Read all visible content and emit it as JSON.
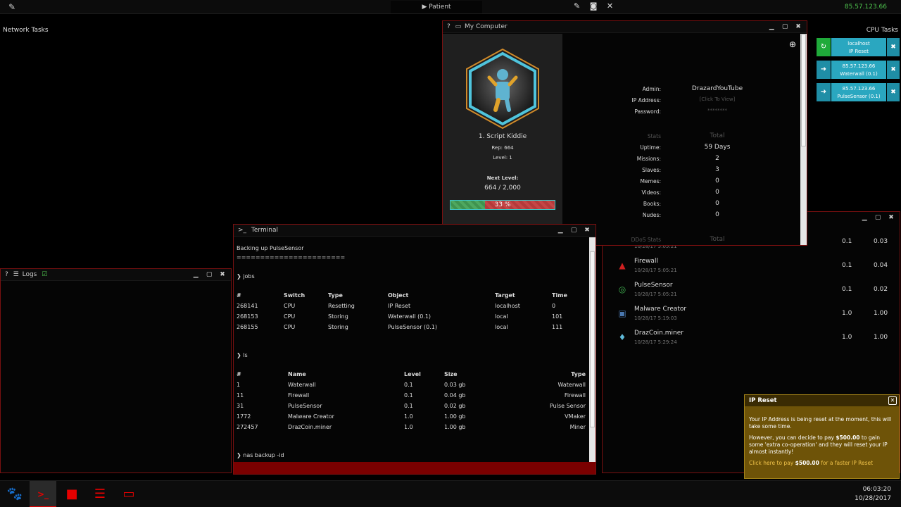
{
  "topbar": {
    "center_tab": "▶  Patient",
    "ip": "85.57.123.66"
  },
  "sections": {
    "network_tasks": "Network Tasks",
    "cpu_tasks": "CPU Tasks"
  },
  "my_computer": {
    "title": "My Computer",
    "rank": "1. Script Kiddie",
    "rep": "Rep: 664",
    "level": "Level: 1",
    "next_level_label": "Next Level:",
    "next_level_value": "664  / 2,000",
    "progress_percent": 33,
    "progress_text": "33 %",
    "info": [
      {
        "label": "Admin:",
        "value": "DrazardYouTube"
      },
      {
        "label": "IP Address:",
        "value": "[Click To View]"
      },
      {
        "label": "Password:",
        "value": "********"
      }
    ],
    "stats_header": {
      "label": "Stats",
      "value": "Total"
    },
    "stats": [
      {
        "label": "Uptime:",
        "value": "59 Days"
      },
      {
        "label": "Missions:",
        "value": "2"
      },
      {
        "label": "Slaves:",
        "value": "3"
      },
      {
        "label": "Memes:",
        "value": "0"
      },
      {
        "label": "Videos:",
        "value": "0"
      },
      {
        "label": "Books:",
        "value": "0"
      },
      {
        "label": "Nudes:",
        "value": "0"
      }
    ],
    "ddos_header": {
      "label": "DDoS Stats",
      "value": "Total"
    }
  },
  "cpu_tasks": [
    {
      "host": "localhost",
      "task": "IP Reset",
      "icon": "↻",
      "color": "#1faa3a"
    },
    {
      "host": "85.57.123.66",
      "task": "Waterwall (0.1)",
      "icon": "➜",
      "color": "#1f8ea6"
    },
    {
      "host": "85.57.123.66",
      "task": "PulseSensor (0.1)",
      "icon": "➜",
      "color": "#1f8ea6"
    }
  ],
  "logs": {
    "title": "Logs"
  },
  "terminal": {
    "title": "Terminal",
    "lines": {
      "backup": "Backing up PulseSensor",
      "separator": "=======================",
      "cmd_jobs": "jobs",
      "cmd_ls": "ls",
      "cmd_nas": "nas backup -id"
    },
    "jobs_headers": [
      "#",
      "Switch",
      "Type",
      "Object",
      "Target",
      "Time"
    ],
    "jobs_rows": [
      [
        "268141",
        "CPU",
        "Resetting",
        "IP Reset",
        "localhost",
        "0"
      ],
      [
        "268153",
        "CPU",
        "Storing",
        "Waterwall (0.1)",
        "local",
        "101"
      ],
      [
        "268155",
        "CPU",
        "Storing",
        "PulseSensor (0.1)",
        "local",
        "111"
      ]
    ],
    "ls_headers": [
      "#",
      "Name",
      "Level",
      "Size",
      "Type"
    ],
    "ls_rows": [
      [
        "1",
        "Waterwall",
        "0.1",
        "0.03 gb",
        "Waterwall"
      ],
      [
        "11",
        "Firewall",
        "0.1",
        "0.04 gb",
        "Firewall"
      ],
      [
        "31",
        "PulseSensor",
        "0.1",
        "0.02 gb",
        "Pulse Sensor"
      ],
      [
        "1772",
        "Malware Creator",
        "1.0",
        "1.00 gb",
        "VMaker"
      ],
      [
        "272457",
        "DrazCoin.miner",
        "1.0",
        "1.00 gb",
        "Miner"
      ]
    ]
  },
  "nas": {
    "items": [
      {
        "name": "",
        "date": "10/28/17 5:05:21",
        "level": "0.1",
        "size": "0.03",
        "icon": "",
        "color": "#777"
      },
      {
        "name": "Firewall",
        "date": "10/28/17 5:05:21",
        "level": "0.1",
        "size": "0.04",
        "icon": "▲",
        "color": "#d02020"
      },
      {
        "name": "PulseSensor",
        "date": "10/28/17 5:05:21",
        "level": "0.1",
        "size": "0.02",
        "icon": "◎",
        "color": "#3fae4f"
      },
      {
        "name": "Malware Creator",
        "date": "10/28/17 5:19:03",
        "level": "1.0",
        "size": "1.00",
        "icon": "▣",
        "color": "#4a78b0"
      },
      {
        "name": "DrazCoin.miner",
        "date": "10/28/17 5:29:24",
        "level": "1.0",
        "size": "1.00",
        "icon": "♦",
        "color": "#5fb9d8"
      }
    ]
  },
  "popup": {
    "title": "IP Reset",
    "p1": "Your IP Address is being reset at the moment, this will take some time.",
    "p2_pre": "However, you can decide to pay ",
    "p2_amount": "$500.00",
    "p2_post": " to gain some 'extra co-operation' and they will reset your IP almost instantly!",
    "link_pre": "Click here to pay ",
    "link_amount": "$500.00",
    "link_post": " for a faster IP Reset"
  },
  "clock": {
    "time": "06:03:20",
    "date": "10/28/2017"
  }
}
